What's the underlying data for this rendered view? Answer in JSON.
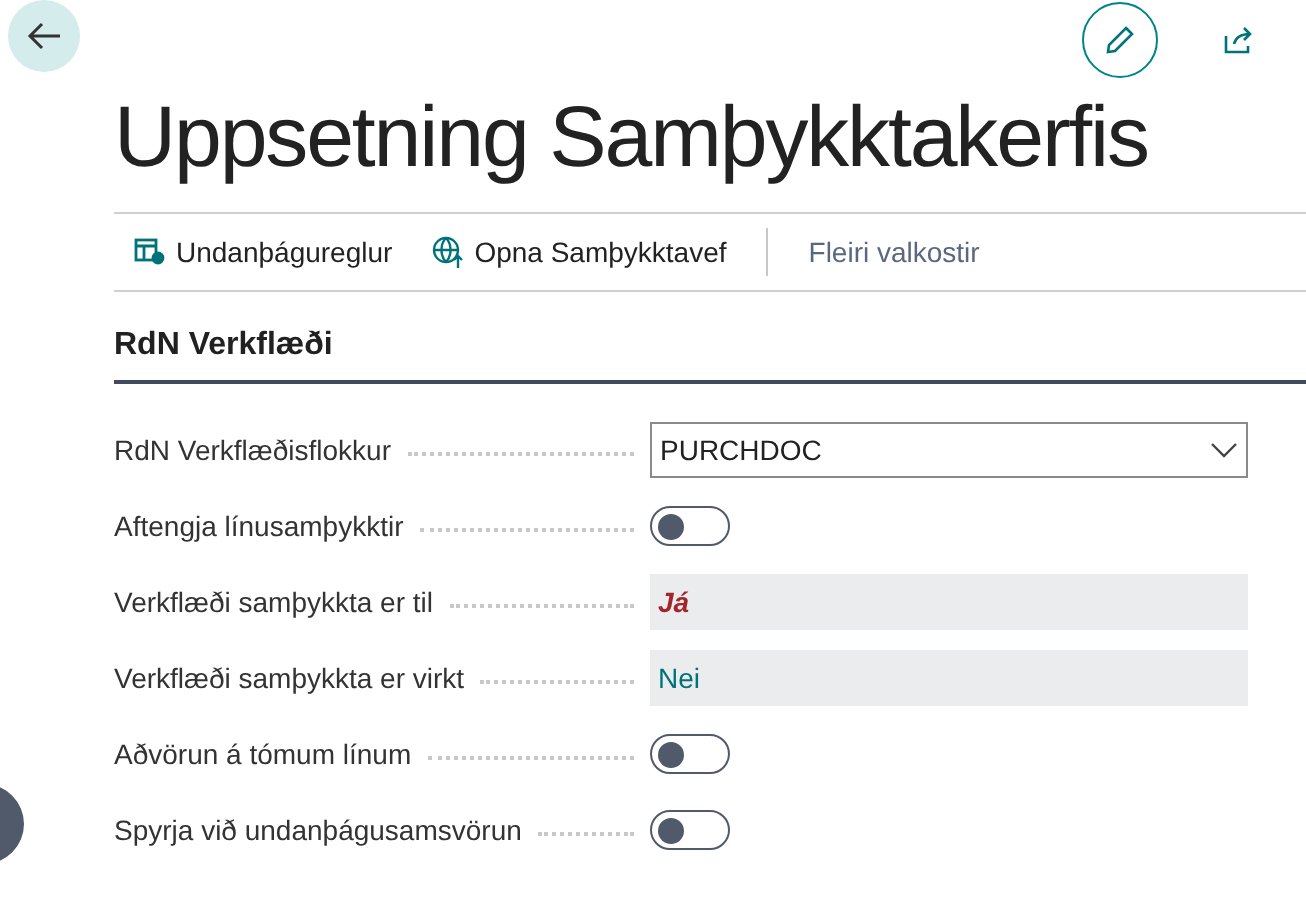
{
  "title": "Uppsetning Samþykktakerfis",
  "actions": [
    {
      "kind": "rules",
      "label": "Undanþágureglur"
    },
    {
      "kind": "web",
      "label": "Opna Samþykktavef"
    }
  ],
  "more_label": "Fleiri valkostir",
  "section": {
    "title": "RdN Verkflæði"
  },
  "fields": [
    {
      "kind": "dropdown",
      "label": "RdN Verkflæðisflokkur",
      "value": "PURCHDOC"
    },
    {
      "kind": "toggle",
      "label": "Aftengja línusamþykktir",
      "on": false
    },
    {
      "kind": "readonly",
      "label": "Verkflæði samþykkta er til",
      "value": "Já",
      "color": "#a4262c",
      "emphasized": true
    },
    {
      "kind": "readonly",
      "label": "Verkflæði samþykkta er virkt",
      "value": "Nei",
      "color": "#00727a",
      "emphasized": false
    },
    {
      "kind": "toggle",
      "label": "Aðvörun á tómum línum",
      "on": false
    },
    {
      "kind": "toggle",
      "label": "Spyrja við undanþágusamsvörun",
      "on": false
    }
  ]
}
